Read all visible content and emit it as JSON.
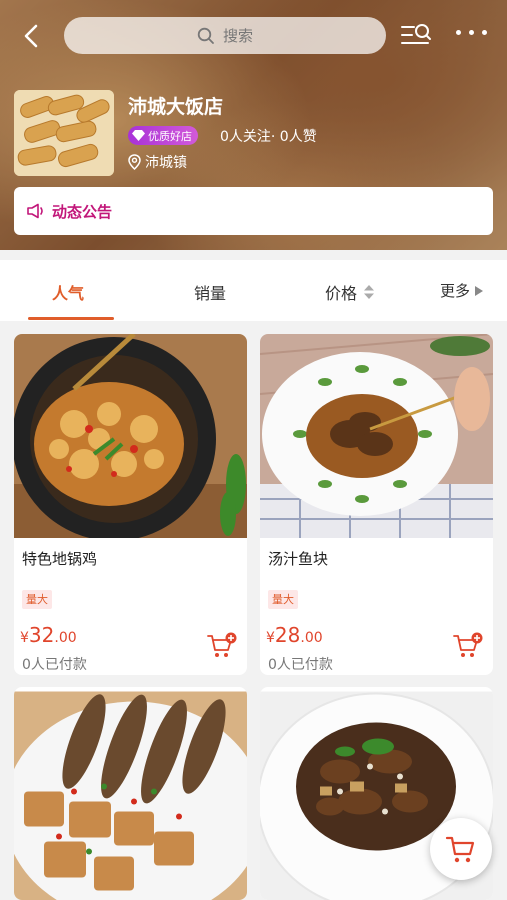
{
  "header": {
    "search_placeholder": "搜索"
  },
  "shop": {
    "name": "沛城大饭店",
    "badge": "优质好店",
    "stats": "0人关注· 0人赞",
    "location": "沛城镇"
  },
  "notice": {
    "label": "动态公告"
  },
  "tabs": [
    {
      "label": "人气",
      "active": true
    },
    {
      "label": "销量"
    },
    {
      "label": "价格"
    },
    {
      "label": "更多"
    }
  ],
  "products": [
    {
      "name": "特色地锅鸡",
      "tag": "量大",
      "currency": "¥",
      "price_int": "32",
      "price_dec": ".00",
      "sales": "0人已付款"
    },
    {
      "name": "汤汁鱼块",
      "tag": "量大",
      "currency": "¥",
      "price_int": "28",
      "price_dec": ".00",
      "sales": "0人已付款"
    }
  ],
  "colors": {
    "accent": "#e05d2a",
    "price": "#e0452c",
    "notice": "#c2177a",
    "badge": "#a832d8"
  }
}
